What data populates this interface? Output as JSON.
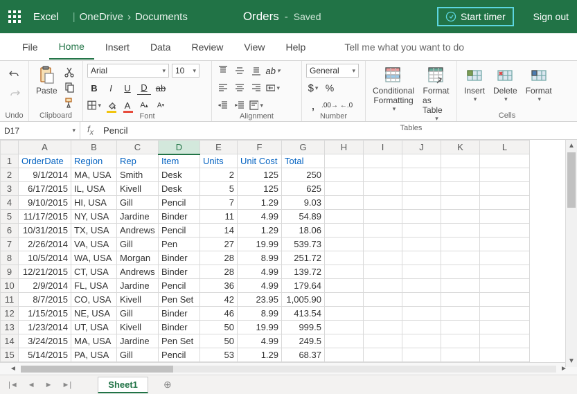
{
  "titlebar": {
    "app": "Excel",
    "breadcrumb1": "OneDrive",
    "breadcrumb2": "Documents",
    "docname": "Orders",
    "saved": "Saved",
    "start_timer": "Start timer",
    "signout": "Sign out"
  },
  "tabs": {
    "file": "File",
    "home": "Home",
    "insert": "Insert",
    "data": "Data",
    "review": "Review",
    "view": "View",
    "help": "Help",
    "tell_me": "Tell me what you want to do"
  },
  "ribbon": {
    "undo_label": "Undo",
    "clipboard_label": "Clipboard",
    "paste": "Paste",
    "font_label": "Font",
    "font_name": "Arial",
    "font_size": "10",
    "alignment_label": "Alignment",
    "number_label": "Number",
    "number_format": "General",
    "tables_label": "Tables",
    "cond_fmt": "Conditional",
    "cond_fmt2": "Formatting",
    "fmt_table": "Format",
    "fmt_table2": "as Table",
    "cells_label": "Cells",
    "insert": "Insert",
    "delete": "Delete",
    "format": "Format"
  },
  "formula_bar": {
    "cell_ref": "D17",
    "content": "Pencil"
  },
  "columns": [
    "A",
    "B",
    "C",
    "D",
    "E",
    "F",
    "G",
    "H",
    "I",
    "J",
    "K",
    "L"
  ],
  "headers": [
    "OrderDate",
    "Region",
    "Rep",
    "Item",
    "Units",
    "Unit Cost",
    "Total"
  ],
  "rows": [
    {
      "n": 2,
      "d": [
        "9/1/2014",
        "MA, USA",
        "Smith",
        "Desk",
        "2",
        "125",
        "250"
      ]
    },
    {
      "n": 3,
      "d": [
        "6/17/2015",
        "IL, USA",
        "Kivell",
        "Desk",
        "5",
        "125",
        "625"
      ]
    },
    {
      "n": 4,
      "d": [
        "9/10/2015",
        "HI, USA",
        "Gill",
        "Pencil",
        "7",
        "1.29",
        "9.03"
      ]
    },
    {
      "n": 5,
      "d": [
        "11/17/2015",
        "NY, USA",
        "Jardine",
        "Binder",
        "11",
        "4.99",
        "54.89"
      ]
    },
    {
      "n": 6,
      "d": [
        "10/31/2015",
        "TX, USA",
        "Andrews",
        "Pencil",
        "14",
        "1.29",
        "18.06"
      ]
    },
    {
      "n": 7,
      "d": [
        "2/26/2014",
        "VA, USA",
        "Gill",
        "Pen",
        "27",
        "19.99",
        "539.73"
      ]
    },
    {
      "n": 8,
      "d": [
        "10/5/2014",
        "WA, USA",
        "Morgan",
        "Binder",
        "28",
        "8.99",
        "251.72"
      ]
    },
    {
      "n": 9,
      "d": [
        "12/21/2015",
        "CT, USA",
        "Andrews",
        "Binder",
        "28",
        "4.99",
        "139.72"
      ]
    },
    {
      "n": 10,
      "d": [
        "2/9/2014",
        "FL, USA",
        "Jardine",
        "Pencil",
        "36",
        "4.99",
        "179.64"
      ]
    },
    {
      "n": 11,
      "d": [
        "8/7/2015",
        "CO, USA",
        "Kivell",
        "Pen Set",
        "42",
        "23.95",
        "1,005.90"
      ]
    },
    {
      "n": 12,
      "d": [
        "1/15/2015",
        "NE, USA",
        "Gill",
        "Binder",
        "46",
        "8.99",
        "413.54"
      ]
    },
    {
      "n": 13,
      "d": [
        "1/23/2014",
        "UT, USA",
        "Kivell",
        "Binder",
        "50",
        "19.99",
        "999.5"
      ]
    },
    {
      "n": 14,
      "d": [
        "3/24/2015",
        "MA, USA",
        "Jardine",
        "Pen Set",
        "50",
        "4.99",
        "249.5"
      ]
    },
    {
      "n": 15,
      "d": [
        "5/14/2015",
        "PA, USA",
        "Gill",
        "Pencil",
        "53",
        "1.29",
        "68.37"
      ]
    }
  ],
  "sheet_tab": "Sheet1",
  "selected_col": "D"
}
